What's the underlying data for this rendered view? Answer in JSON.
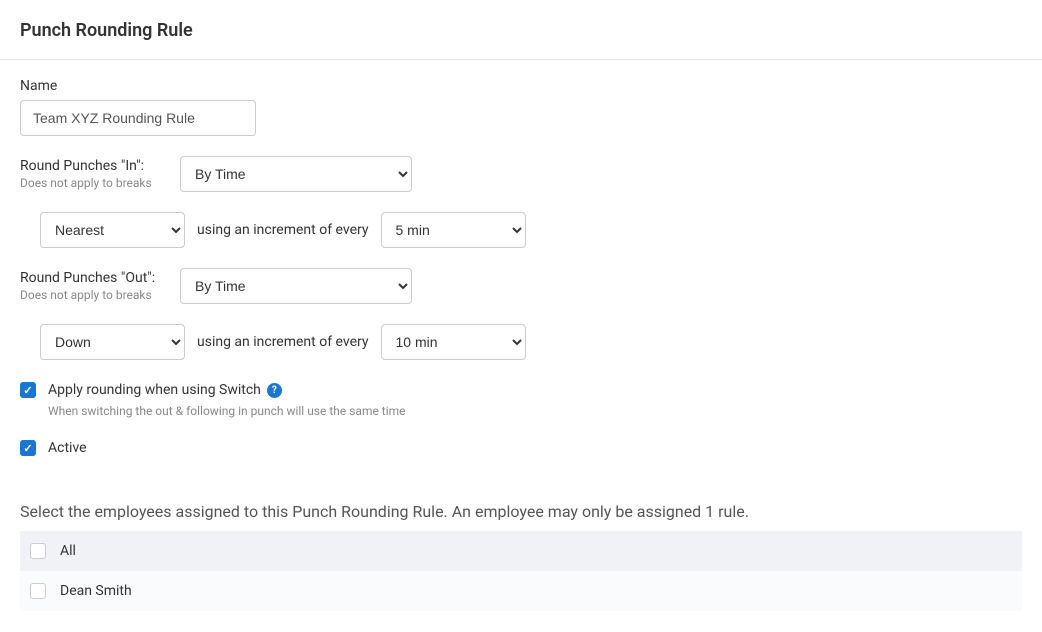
{
  "page": {
    "title": "Punch Rounding Rule"
  },
  "nameField": {
    "label": "Name",
    "value": "Team XYZ Rounding Rule"
  },
  "roundIn": {
    "label": "Round Punches \"In\":",
    "sub": "Does not apply to breaks",
    "mode": "By Time",
    "direction": "Nearest",
    "incrementText": "using an increment of every",
    "increment": "5 min"
  },
  "roundOut": {
    "label": "Round Punches \"Out\":",
    "sub": "Does not apply to breaks",
    "mode": "By Time",
    "direction": "Down",
    "incrementText": "using an increment of every",
    "increment": "10 min"
  },
  "switchOption": {
    "checked": true,
    "label": "Apply rounding when using Switch",
    "helper": "When switching the out & following in punch will use the same time"
  },
  "activeOption": {
    "checked": true,
    "label": "Active"
  },
  "employeesSection": {
    "intro": "Select the employees assigned to this Punch Rounding Rule. An employee may only be assigned 1 rule.",
    "allLabel": "All",
    "rows": [
      {
        "name": "Dean Smith",
        "checked": false
      }
    ]
  }
}
